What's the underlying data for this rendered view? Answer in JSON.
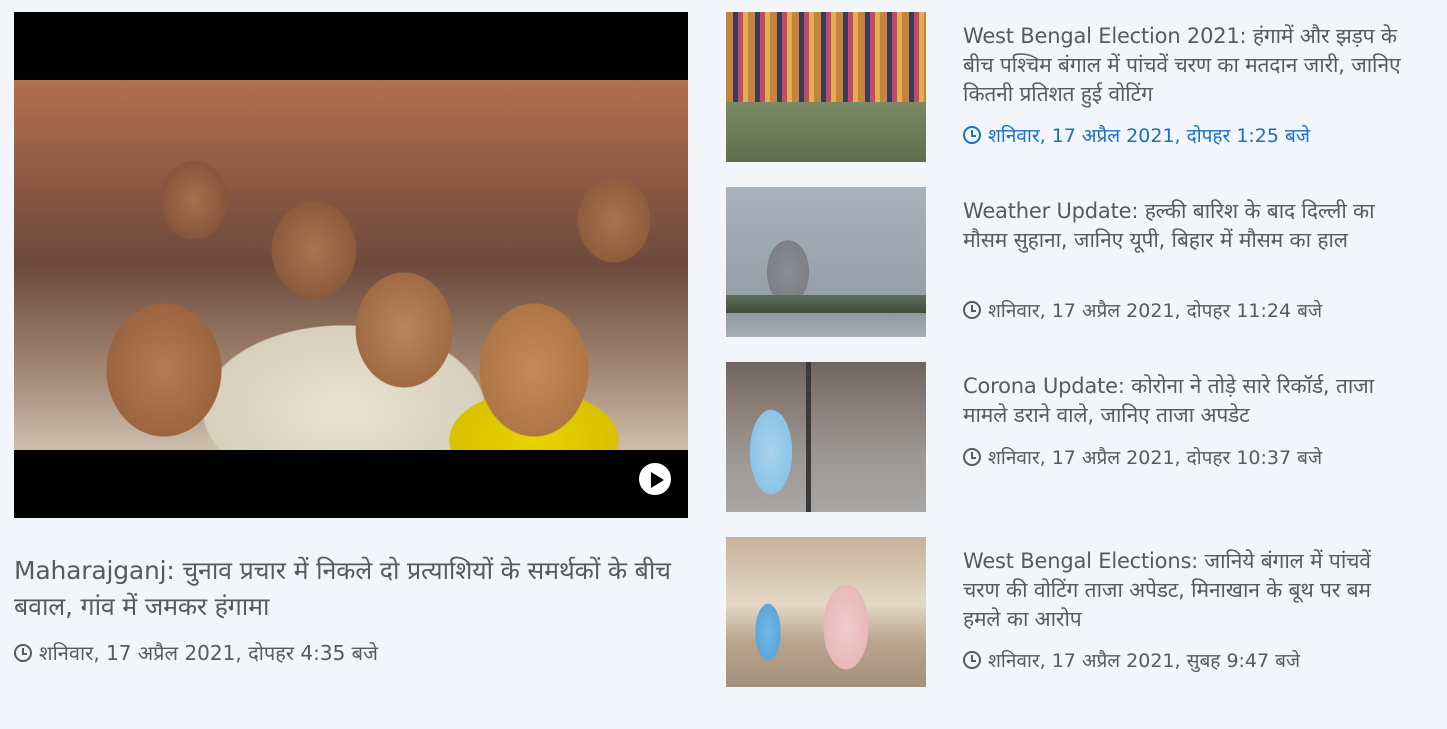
{
  "featured": {
    "title": "Maharajganj: चुनाव प्रचार में निकले दो प्रत्याशियों के समर्थकों के बीच बवाल, गांव में जमकर हंगामा",
    "time": "शनिवार, 17 अप्रैल 2021, दोपहर 4:35 बजे",
    "play_icon": "play-icon",
    "clock_icon": "clock-icon"
  },
  "articles": [
    {
      "title": "West Bengal Election 2021: हंगामें और झड़प के बीच पश्चिम बंगाल में पांचवें चरण का मतदान जारी, जानिए कितनी प्रतिशत हुई वोटिंग",
      "time": "शनिवार, 17 अप्रैल 2021, दोपहर 1:25 बजे",
      "time_color": "#1a6fc2"
    },
    {
      "title": "Weather Update: हल्की बारिश के बाद दिल्ली का मौसम सुहाना, जानिए यूपी, बिहार में मौसम का हाल",
      "time": "शनिवार, 17 अप्रैल 2021, दोपहर 11:24 बजे"
    },
    {
      "title": "Corona Update: कोरोना ने तोड़े सारे रिकॉर्ड, ताजा मामले डराने वाले, जानिए ताजा अपडेट",
      "time": "शनिवार, 17 अप्रैल 2021, दोपहर 10:37 बजे"
    },
    {
      "title": "West Bengal Elections: जानिये बंगाल में पांचवें चरण की वोटिंग ताजा अपेडट, मिनाखान के बूथ पर बम हमले का आरोप",
      "time": "शनिवार, 17 अप्रैल 2021, सुबह 9:47 बजे"
    }
  ]
}
